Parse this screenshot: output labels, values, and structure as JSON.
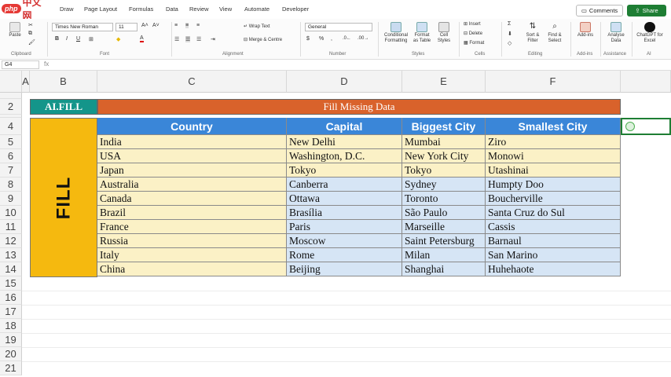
{
  "logo": {
    "badge": "php",
    "text": "中文网"
  },
  "tabs": [
    "Draw",
    "Page Layout",
    "Formulas",
    "Data",
    "Review",
    "View",
    "Automate",
    "Developer"
  ],
  "actions": {
    "comments": "Comments",
    "share": "Share"
  },
  "ribbon": {
    "paste": "Paste",
    "font_name": "Times New Roman",
    "font_size": "11",
    "wrap_text": "Wrap Text",
    "merge_center": "Merge & Centre",
    "number_format": "General",
    "conditional": "Conditional Formatting",
    "format_table": "Format as Table",
    "cell_styles": "Cell Styles",
    "insert": "Insert",
    "delete": "Delete",
    "format": "Format",
    "sort_filter": "Sort & Filter",
    "find_select": "Find & Select",
    "addins": "Add-ins",
    "analyse": "Analyse Data",
    "chatgpt": "ChatGPT for Excel",
    "groups": [
      "Clipboard",
      "Font",
      "Alignment",
      "Number",
      "Styles",
      "Cells",
      "Editing",
      "Add-ins",
      "Assistance",
      "AI"
    ]
  },
  "formula_bar": {
    "name_box": "G4",
    "fx": "fx",
    "value": ""
  },
  "columns": [
    "A",
    "B",
    "C",
    "D",
    "E",
    "F"
  ],
  "rows": [
    "1",
    "2",
    "3",
    "4",
    "5",
    "6",
    "7",
    "8",
    "9",
    "10",
    "11",
    "12",
    "13",
    "14",
    "15",
    "16",
    "17",
    "18",
    "19",
    "20",
    "21"
  ],
  "sheet": {
    "tag": "AI.FILL",
    "title": "Fill Missing Data",
    "side_label": "FILL",
    "headers": [
      "Country",
      "Capital",
      "Biggest City",
      "Smallest City"
    ],
    "data": [
      [
        "India",
        "New Delhi",
        "Mumbai",
        "Ziro"
      ],
      [
        "USA",
        "Washington, D.C.",
        "New York City",
        "Monowi"
      ],
      [
        "Japan",
        "Tokyo",
        "Tokyo",
        "Utashinai"
      ],
      [
        "Australia",
        "Canberra",
        "Sydney",
        "Humpty Doo"
      ],
      [
        "Canada",
        "Ottawa",
        "Toronto",
        "Boucherville"
      ],
      [
        "Brazil",
        "Brasília",
        "São Paulo",
        "Santa Cruz do Sul"
      ],
      [
        "France",
        "Paris",
        "Marseille",
        "Cassis"
      ],
      [
        "Russia",
        "Moscow",
        "Saint Petersburg",
        "Barnaul"
      ],
      [
        "Italy",
        "Rome",
        "Milan",
        "San Marino"
      ],
      [
        "China",
        "Beijing",
        "Shanghai",
        "Huhehaote"
      ]
    ]
  },
  "colors": {
    "header_blue": "#3a86d8",
    "tag_teal": "#14958a",
    "title_orange": "#d9622b",
    "fill_yellow": "#f5b90f",
    "row_yellow": "#fbf1c6",
    "row_blue": "#d6e5f5",
    "share_green": "#1e7e34"
  }
}
